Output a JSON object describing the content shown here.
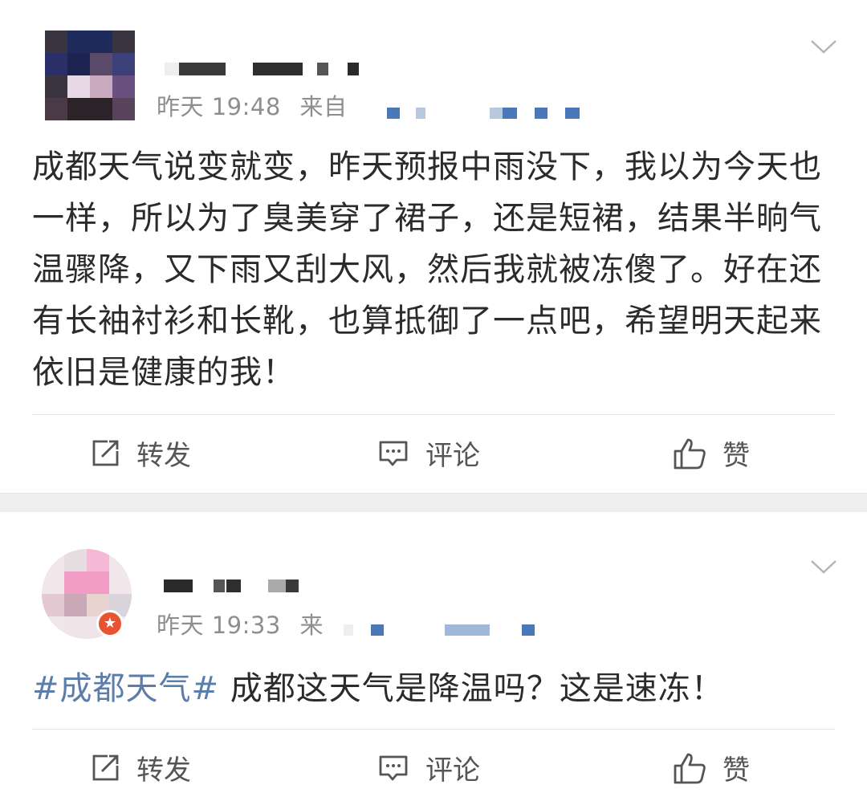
{
  "posts": [
    {
      "timestamp": "昨天 19:48",
      "source_prefix": "来自",
      "content": "成都天气说变就变，昨天预报中雨没下，我以为今天也一样，所以为了臭美穿了裙子，还是短裙，结果半晌气温骤降，又下雨又刮大风，然后我就被冻傻了。好在还有长袖衬衫和长靴，也算抵御了一点吧，希望明天起来依旧是健康的我！",
      "actions": {
        "repost": "转发",
        "comment": "评论",
        "like": "赞"
      }
    },
    {
      "timestamp": "昨天 19:33",
      "source_prefix": "来",
      "topic": "#成都天气#",
      "content": " 成都这天气是降温吗？这是速冻！",
      "actions": {
        "repost": "转发",
        "comment": "评论",
        "like": "赞"
      }
    }
  ],
  "icons": [
    "chevron-down-icon",
    "repost-icon",
    "comment-icon",
    "like-icon",
    "verified-badge-icon"
  ],
  "colors": {
    "topic": "#5b7dab",
    "meta": "#8e8e8e",
    "text": "#2b2b2b",
    "separator": "#eeeeee",
    "badge": "#e8542f"
  }
}
